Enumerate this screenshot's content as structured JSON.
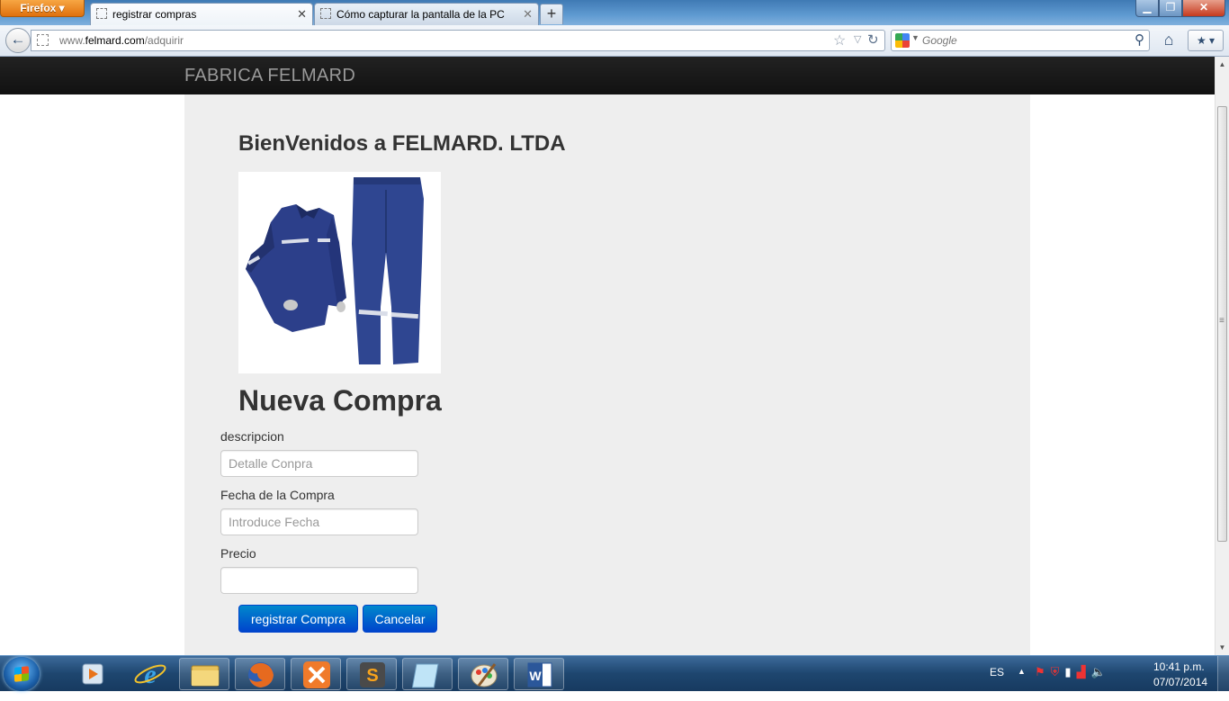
{
  "browser": {
    "menu_label": "Firefox",
    "tabs": [
      {
        "title": "registrar compras",
        "active": true
      },
      {
        "title": "Cómo capturar la pantalla de la PC",
        "active": false
      }
    ],
    "new_tab_label": "+",
    "window_buttons": {
      "minimize": "▁",
      "maximize": "❐",
      "close": "✕"
    },
    "url_domain_prefix": "www.",
    "url_domain": "felmard.com",
    "url_path": "/adquirir",
    "search_placeholder": "Google"
  },
  "site": {
    "brand": "FABRICA FELMARD",
    "welcome": "BienVenidos a FELMARD. LTDA",
    "product_image_icon": "work-uniform-image",
    "form_title": "Nueva Compra",
    "fields": {
      "descripcion": {
        "label": "descripcion",
        "placeholder": "Detalle Conpra",
        "value": ""
      },
      "fecha": {
        "label": "Fecha de la Compra",
        "placeholder": "Introduce Fecha",
        "value": ""
      },
      "precio": {
        "label": "Precio",
        "placeholder": "",
        "value": ""
      }
    },
    "buttons": {
      "register": "registrar Compra",
      "cancel": "Cancelar"
    },
    "colors": {
      "navbar": "#1b1b1b",
      "container": "#eeeeee",
      "primary": "#0068cc",
      "jacket": "#2c3f8a"
    }
  },
  "taskbar": {
    "apps": [
      "media-center-icon",
      "internet-explorer-icon",
      "file-explorer-icon",
      "firefox-icon",
      "xampp-icon",
      "sublime-text-icon",
      "notepad-icon",
      "paint-icon",
      "word-icon"
    ],
    "language": "ES",
    "time": "10:41 p.m.",
    "date": "07/07/2014"
  }
}
